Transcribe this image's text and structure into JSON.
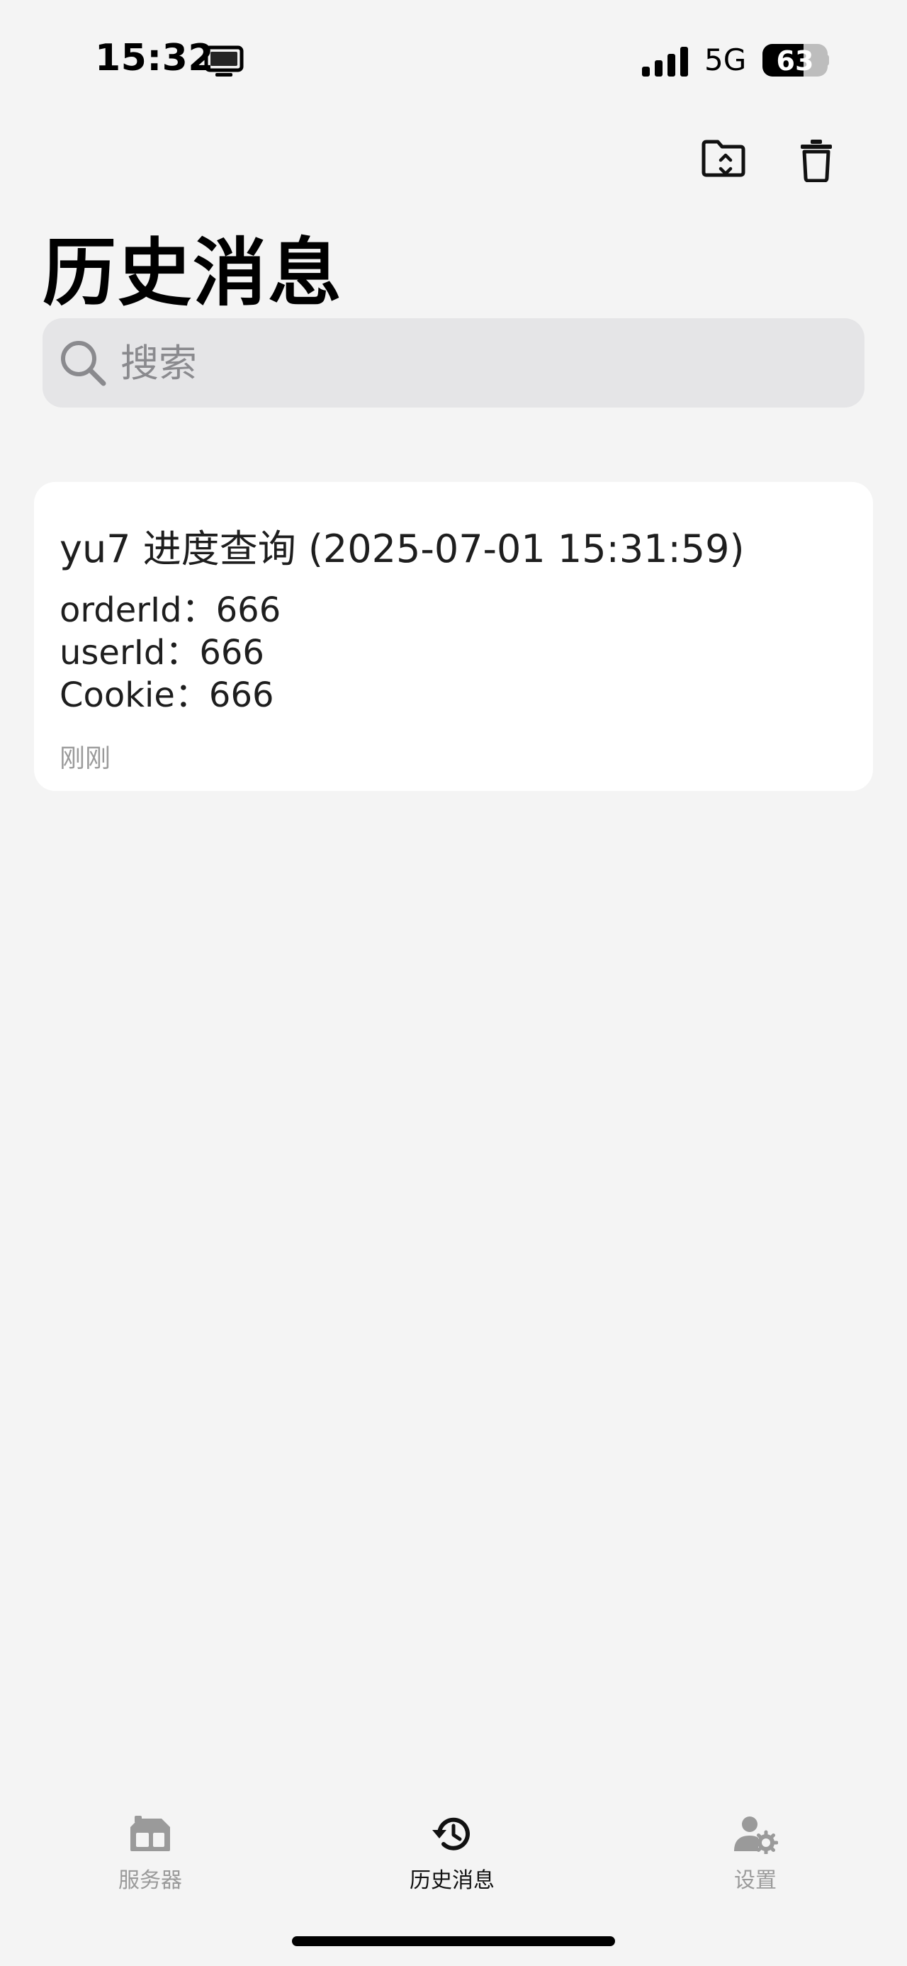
{
  "status_bar": {
    "time": "15:32",
    "network": "5G",
    "battery": "63",
    "battery_level_percent": 63,
    "icons": [
      "screen-icon",
      "signal-icon",
      "battery-icon"
    ]
  },
  "toolbar": {
    "icons": [
      "folder-sync-icon",
      "trash-icon"
    ]
  },
  "page": {
    "title": "历史消息"
  },
  "search": {
    "placeholder": "搜索",
    "value": ""
  },
  "messages": [
    {
      "title": "yu7 进度查询 (2025-07-01 15:31:59)",
      "lines": [
        "orderId：666",
        "userId：666",
        "Cookie：666"
      ],
      "time": "刚刚"
    }
  ],
  "tab_bar": {
    "tabs": [
      {
        "label": "服务器",
        "icon": "server-icon",
        "active": false
      },
      {
        "label": "历史消息",
        "icon": "history-icon",
        "active": true
      },
      {
        "label": "设置",
        "icon": "user-settings-icon",
        "active": false
      }
    ]
  },
  "colors": {
    "background": "#f4f4f4",
    "card": "#ffffff",
    "search_bg": "#e5e5e7",
    "active_tab": "#111111",
    "inactive_tab": "#9a9a9a"
  }
}
